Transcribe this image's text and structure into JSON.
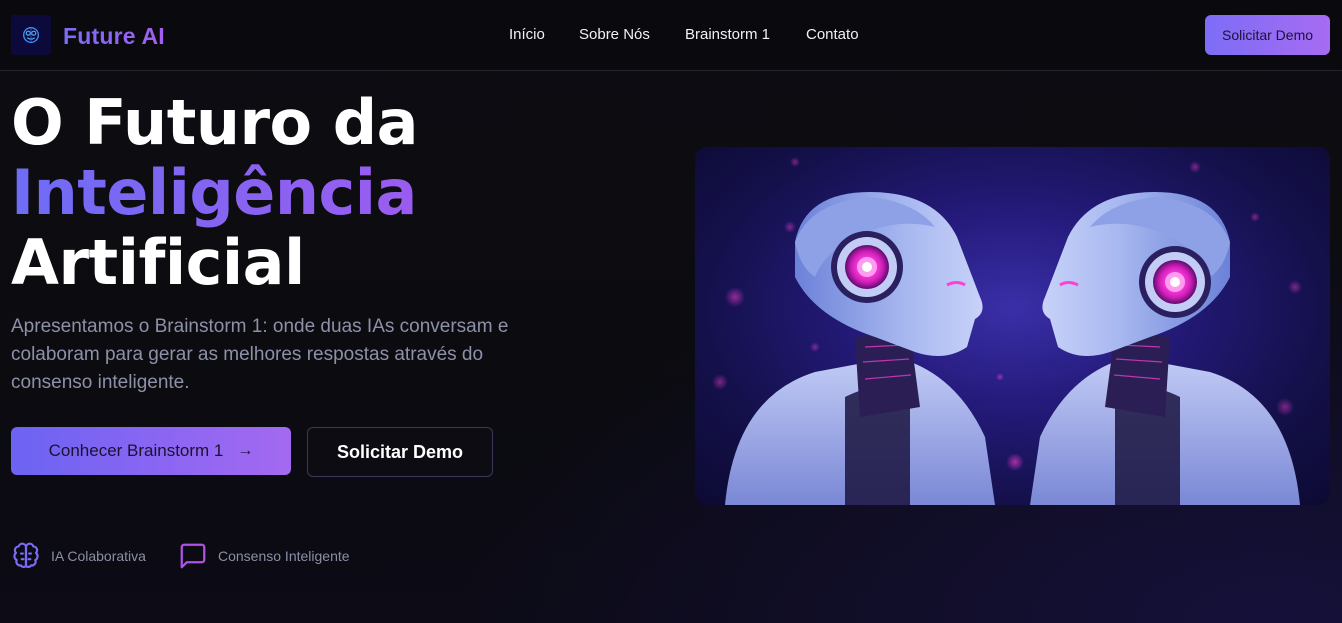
{
  "nav": {
    "brand": "Future AI",
    "logo_icon": "brain-chip-icon",
    "links": [
      "Início",
      "Sobre Nós",
      "Brainstorm 1",
      "Contato"
    ],
    "cta_label": "Solicitar Demo"
  },
  "hero": {
    "title_line1": "O Futuro da",
    "title_line2": "Inteligência",
    "title_line3": "Artificial",
    "description": "Apresentamos o Brainstorm 1: onde duas IAs conversam e colaboram para gerar as melhores respostas através do consenso inteligente.",
    "primary_button": "Conhecer Brainstorm 1",
    "primary_button_icon": "arrow-right-icon",
    "secondary_button": "Solicitar Demo",
    "features": [
      {
        "label": "IA Colaborativa",
        "icon": "brain-icon"
      },
      {
        "label": "Consenso Inteligente",
        "icon": "message-square-icon"
      }
    ],
    "image_subject": "two-humanoid-robots-facing-each-other"
  },
  "colors": {
    "accent_start": "#6c63f3",
    "accent_end": "#a469f1",
    "background": "#0b0b10",
    "muted_text": "#8d91a8",
    "glow_pink": "#ff2fd0"
  }
}
